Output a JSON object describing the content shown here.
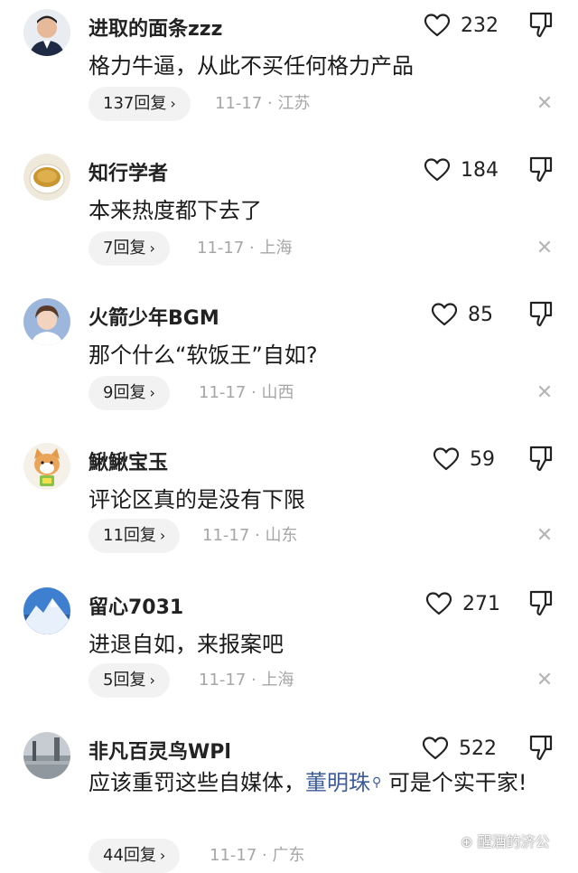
{
  "colors": {
    "text": "#1a1a1a",
    "meta": "#a6a6a6",
    "pill": "#f2f2f2",
    "mention": "#3d5c99"
  },
  "icons": {
    "like": "heart-outline-icon",
    "dislike": "thumb-down-icon",
    "close": "close-icon",
    "chevron": "chevron-right-icon",
    "mention": "search-icon"
  },
  "comments": [
    {
      "username": "进取的面条zzz",
      "text": "格力牛逼，从此不买任何格力产品",
      "likes": "232",
      "replies": "137回复",
      "date": "11-17 · 江苏"
    },
    {
      "username": "知行学者",
      "text": "本来热度都下去了",
      "likes": "184",
      "replies": "7回复",
      "date": "11-17 · 上海"
    },
    {
      "username": "火箭少年BGM",
      "text": "那个什么“软饭王”自如?",
      "likes": "85",
      "replies": "9回复",
      "date": "11-17 · 山西"
    },
    {
      "username": "鰍鰍宝玉",
      "text": "评论区真的是没有下限",
      "likes": "59",
      "replies": "11回复",
      "date": "11-17 · 山东"
    },
    {
      "username": "留心7031",
      "text": "进退自如，来报案吧",
      "likes": "271",
      "replies": "5回复",
      "date": "11-17 · 上海"
    },
    {
      "username": "非凡百灵鸟WPl",
      "text_before": "应该重罚这些自媒体，",
      "mention": "董明珠",
      "text_after": "可是个实干家!",
      "likes": "522",
      "replies": "44回复",
      "date": "11-17 · 广东"
    }
  ],
  "ui": {
    "chevron": "›",
    "close": "✕",
    "mention_glyph": "⚲"
  },
  "watermark": "⊕ 醒酒的济公"
}
